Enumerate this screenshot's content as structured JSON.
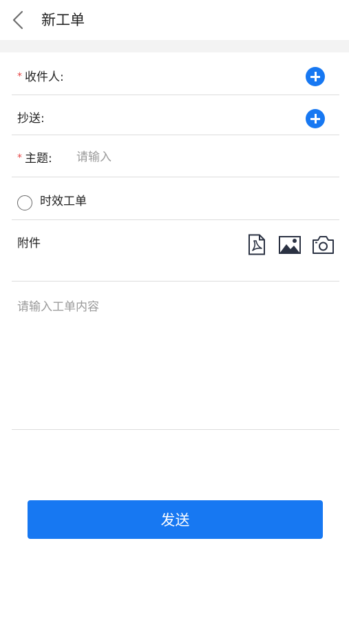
{
  "header": {
    "title": "新工单",
    "back_icon": "chevron-left-icon"
  },
  "form": {
    "recipient": {
      "required_mark": "*",
      "label": "收件人:",
      "add_icon": "plus-circle-icon"
    },
    "cc": {
      "label": "抄送:",
      "add_icon": "plus-circle-icon"
    },
    "subject": {
      "required_mark": "*",
      "label": "主题:",
      "placeholder": "请输入"
    },
    "timely": {
      "label": "时效工单",
      "checked": false
    },
    "attachment": {
      "label": "附件",
      "icons": [
        "pdf-icon",
        "image-icon",
        "camera-icon"
      ]
    },
    "content": {
      "placeholder": "请输入工单内容"
    }
  },
  "actions": {
    "send_label": "发送"
  },
  "colors": {
    "accent": "#1778f2",
    "required": "#e54545",
    "placeholder": "#9a9a9a",
    "divider": "#dcdcdc",
    "section_gap": "#f3f3f3"
  }
}
